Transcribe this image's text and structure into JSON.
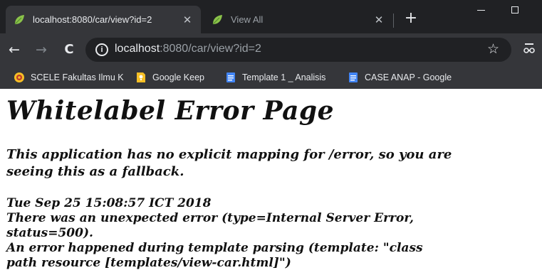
{
  "browser": {
    "tabs": [
      {
        "title": "localhost:8080/car/view?id=2",
        "active": true
      },
      {
        "title": "View All",
        "active": false
      }
    ],
    "new_tab_symbol": "+",
    "address": {
      "host": "localhost",
      "rest": ":8080/car/view?id=2"
    },
    "icons": {
      "back": "arrow-left-icon",
      "forward": "arrow-right-icon",
      "reload": "reload-icon",
      "info": "info-icon",
      "star": "star-icon",
      "extension": "extension-icon",
      "tab_favicon": "leaf-icon"
    },
    "bookmarks": [
      {
        "label": "SCELE Fakultas Ilmu K"
      },
      {
        "label": "Google Keep"
      },
      {
        "label": "Template 1 _ Analisis"
      },
      {
        "label": "CASE ANAP - Google"
      }
    ],
    "colors": {
      "frame": "#202124",
      "toolbar": "#35363a",
      "favicon": "#8bc34a",
      "keep": "#f6bf26",
      "docs": "#4285f4"
    }
  },
  "error_page": {
    "heading": "Whitelabel Error Page",
    "intro_line1": "This application has no explicit mapping for /error, so you are",
    "intro_line2": "seeing this as a fallback.",
    "timestamp": "Tue Sep 25 15:08:57 ICT 2018",
    "error_line1": "There was an unexpected error (type=Internal Server Error,",
    "error_line2": "status=500).",
    "message_line1": "An error happened during template parsing (template: \"class",
    "message_line2": "path resource [templates/view-car.html]\")"
  }
}
